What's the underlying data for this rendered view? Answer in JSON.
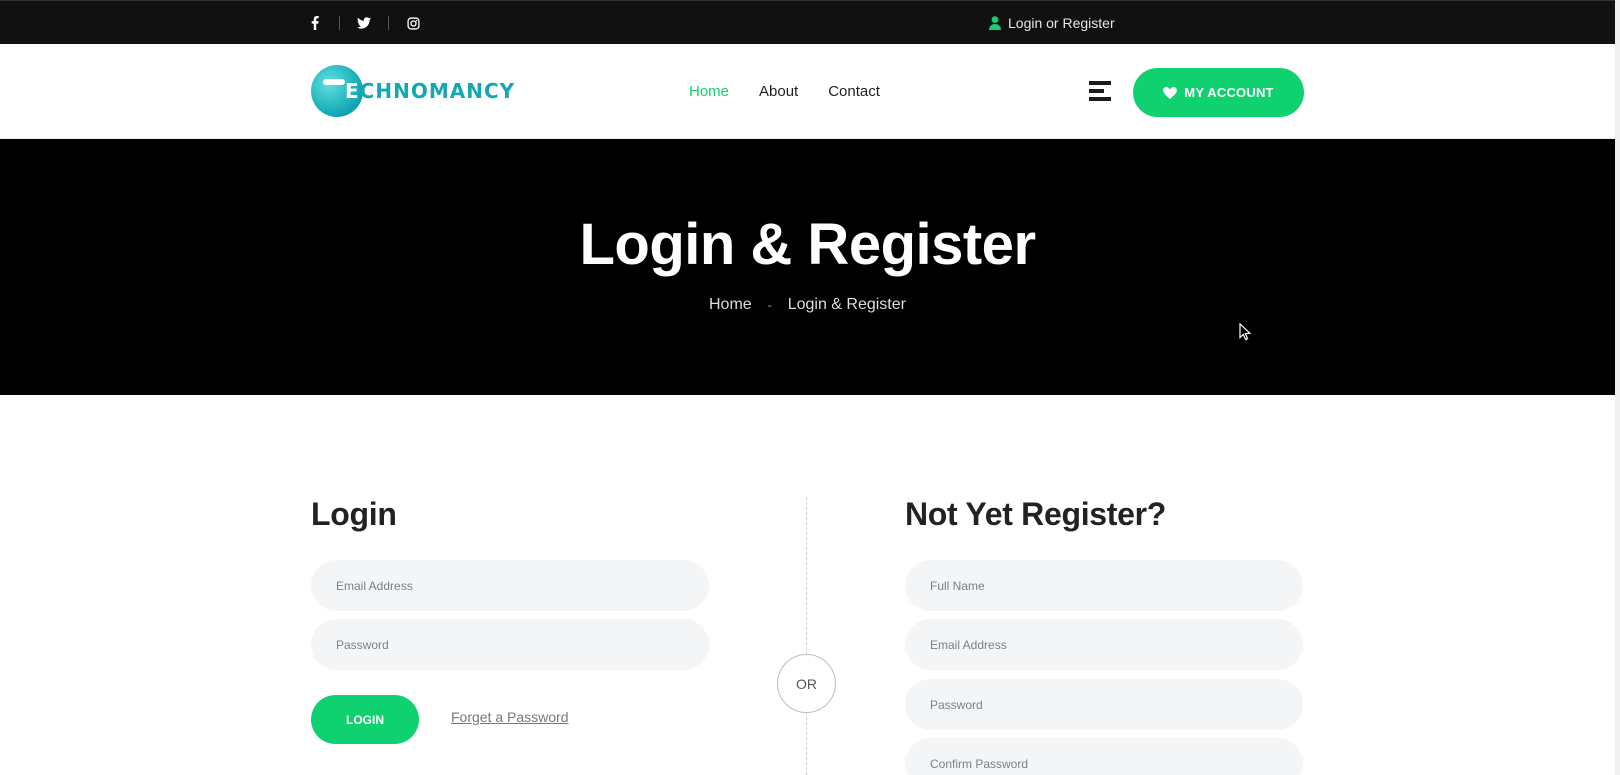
{
  "topbar": {
    "social": [
      {
        "icon": "facebook-icon"
      },
      {
        "icon": "twitter-icon"
      },
      {
        "icon": "instagram-icon"
      }
    ],
    "account_link": "Login or Register"
  },
  "header": {
    "logo_text_first": "E",
    "logo_text_rest": "CHNOMANCY",
    "nav": [
      "Home",
      "About",
      "Contact"
    ],
    "active_nav": "Home",
    "account_button": "MY ACCOUNT"
  },
  "hero": {
    "title": "Login & Register",
    "breadcrumb": {
      "home": "Home",
      "separator": "-",
      "current": "Login & Register"
    }
  },
  "login": {
    "title": "Login",
    "email_placeholder": "Email Address",
    "password_placeholder": "Password",
    "login_button": "LOGIN",
    "forgot_link": "Forget a Password"
  },
  "divider": {
    "or_label": "OR"
  },
  "register": {
    "title": "Not Yet Register?",
    "fullname_placeholder": "Full Name",
    "email_placeholder": "Email Address",
    "password_placeholder": "Password",
    "confirm_placeholder": "Confirm Password"
  },
  "colors": {
    "accent": "#0fd170",
    "topbar_bg": "#111111",
    "hero_bg": "#000000",
    "logo": "#15a7b4",
    "field_bg": "#f3f5f6"
  }
}
